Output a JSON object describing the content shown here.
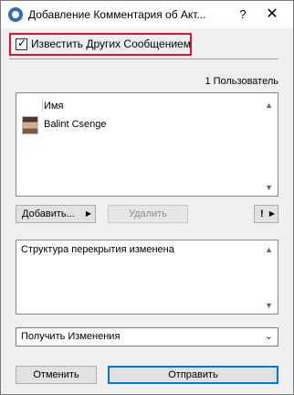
{
  "window": {
    "title": "Добавление Комментария об Акт...",
    "help_label": "?",
    "close_label": "✕"
  },
  "notify": {
    "label": "Известить Других Сообщением",
    "checked": true,
    "checkmark": "✓"
  },
  "users": {
    "count_label": "1 Пользователь",
    "column_header": "Имя",
    "items": [
      {
        "name": "Balint Csenge"
      }
    ],
    "scroll_up": "▲",
    "scroll_down": "▼"
  },
  "actions": {
    "add_label": "Добавить...",
    "add_arrow": "▶",
    "delete_label": "Удалить",
    "excl_label": "!",
    "excl_arrow": "▶"
  },
  "comment": {
    "text": "Структура перекрытия изменена",
    "scroll_up": "▲",
    "scroll_down": "▼"
  },
  "mode_select": {
    "value": "Получить Изменения",
    "arrow": "⌄"
  },
  "footer": {
    "cancel_label": "Отменить",
    "send_label": "Отправить"
  },
  "colors": {
    "highlight": "#e0142b",
    "default_button_border": "#0078d7",
    "app_icon": "#2c6fb2"
  }
}
